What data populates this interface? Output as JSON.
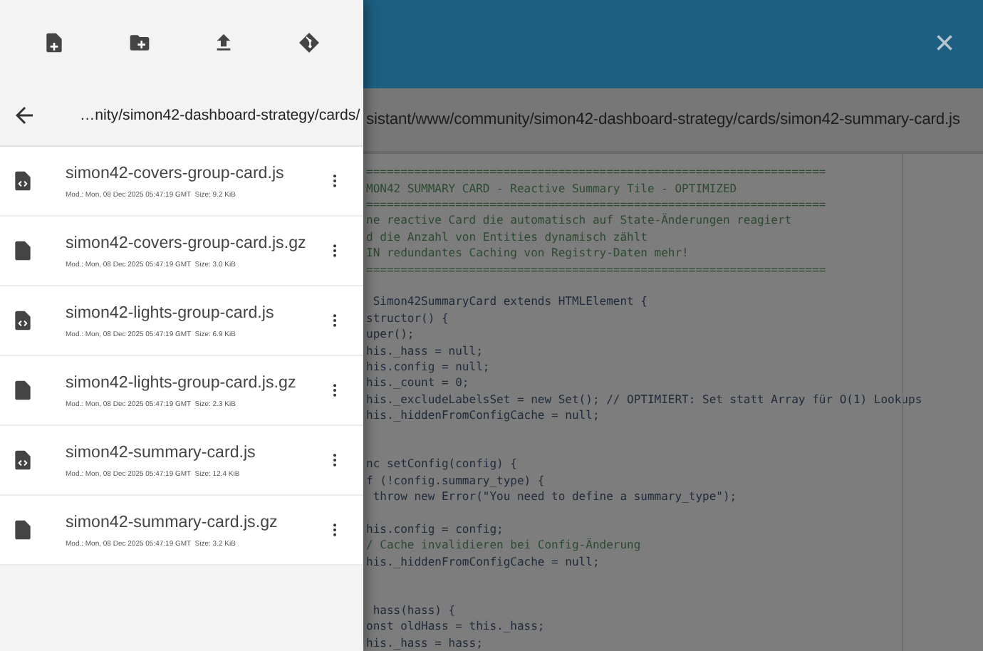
{
  "drawer": {
    "breadcrumb": "…nity/simon42-dashboard-strategy/cards/",
    "files": [
      {
        "name": "simon42-covers-group-card.js",
        "meta": "Mod.: Mon, 08 Dec 2025 05:47:19 GMT  Size: 9.2 KiB",
        "kind": "code"
      },
      {
        "name": "simon42-covers-group-card.js.gz",
        "meta": "Mod.: Mon, 08 Dec 2025 05:47:19 GMT  Size: 3.0 KiB",
        "kind": "file"
      },
      {
        "name": "simon42-lights-group-card.js",
        "meta": "Mod.: Mon, 08 Dec 2025 05:47:19 GMT  Size: 6.9 KiB",
        "kind": "code"
      },
      {
        "name": "simon42-lights-group-card.js.gz",
        "meta": "Mod.: Mon, 08 Dec 2025 05:47:19 GMT  Size: 2.3 KiB",
        "kind": "file"
      },
      {
        "name": "simon42-summary-card.js",
        "meta": "Mod.: Mon, 08 Dec 2025 05:47:19 GMT  Size: 12.4 KiB",
        "kind": "code"
      },
      {
        "name": "simon42-summary-card.js.gz",
        "meta": "Mod.: Mon, 08 Dec 2025 05:47:19 GMT  Size: 3.2 KiB",
        "kind": "file"
      }
    ]
  },
  "editor": {
    "close": "×",
    "path": "sistant/www/community/simon42-dashboard-strategy/cards/simon42-summary-card.js",
    "lines": [
      {
        "text": "===================================================================",
        "kind": "comment"
      },
      {
        "text": "MON42 SUMMARY CARD - Reactive Summary Tile - OPTIMIZED",
        "kind": "comment"
      },
      {
        "text": "===================================================================",
        "kind": "comment"
      },
      {
        "text": "ne reactive Card die automatisch auf State-Änderungen reagiert",
        "kind": "comment"
      },
      {
        "text": "d die Anzahl von Entities dynamisch zählt",
        "kind": "comment"
      },
      {
        "text": "IN redundantes Caching von Registry-Daten mehr!",
        "kind": "comment"
      },
      {
        "text": "===================================================================",
        "kind": "comment"
      },
      {
        "kind": "blank"
      },
      {
        "text": " Simon42SummaryCard extends HTMLElement {",
        "kind": "code"
      },
      {
        "text": "structor() {",
        "kind": "code"
      },
      {
        "text": "uper();",
        "kind": "code"
      },
      {
        "text": "his._hass = null;",
        "kind": "code"
      },
      {
        "text": "his.config = null;",
        "kind": "code"
      },
      {
        "text": "his._count = 0;",
        "kind": "code"
      },
      {
        "text": "his._excludeLabelsSet = new Set(); // OPTIMIERT: Set statt Array für O(1) Lookups",
        "kind": "code"
      },
      {
        "text": "his._hiddenFromConfigCache = null;",
        "kind": "code"
      },
      {
        "kind": "blank"
      },
      {
        "kind": "blank"
      },
      {
        "text": "nc setConfig(config) {",
        "kind": "code"
      },
      {
        "text": "f (!config.summary_type) {",
        "kind": "code"
      },
      {
        "text": " throw new Error(\"You need to define a summary_type\");",
        "kind": "code"
      },
      {
        "kind": "blank"
      },
      {
        "text": "his.config = config;",
        "kind": "code"
      },
      {
        "text": "/ Cache invalidieren bei Config-Änderung",
        "kind": "comment"
      },
      {
        "text": "his._hiddenFromConfigCache = null;",
        "kind": "code"
      },
      {
        "kind": "blank"
      },
      {
        "kind": "blank"
      },
      {
        "text": " hass(hass) {",
        "kind": "code"
      },
      {
        "text": "onst oldHass = this._hass;",
        "kind": "code"
      },
      {
        "text": "his._hass = hass;",
        "kind": "code"
      }
    ]
  }
}
